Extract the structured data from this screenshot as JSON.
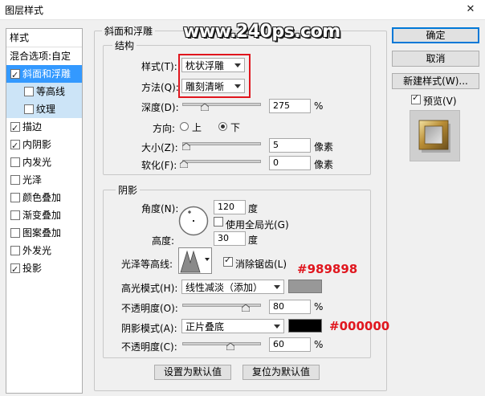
{
  "window": {
    "title": "图层样式",
    "close_glyph": "✕"
  },
  "watermark": "www.240ps.com",
  "left_list": {
    "header1": "样式",
    "header2": "混合选项:自定",
    "items": [
      {
        "label": "斜面和浮雕",
        "checked": true
      },
      {
        "label": "等高线",
        "checked": false
      },
      {
        "label": "纹理",
        "checked": false
      },
      {
        "label": "描边",
        "checked": true
      },
      {
        "label": "内阴影",
        "checked": true
      },
      {
        "label": "内发光",
        "checked": false
      },
      {
        "label": "光泽",
        "checked": false
      },
      {
        "label": "颜色叠加",
        "checked": false
      },
      {
        "label": "渐变叠加",
        "checked": false
      },
      {
        "label": "图案叠加",
        "checked": false
      },
      {
        "label": "外发光",
        "checked": false
      },
      {
        "label": "投影",
        "checked": true
      }
    ]
  },
  "bevel": {
    "group_title": "斜面和浮雕",
    "structure_title": "结构",
    "style_label": "样式(T):",
    "style_value": "枕状浮雕",
    "method_label": "方法(Q):",
    "method_value": "雕刻清晰",
    "depth_label": "深度(D):",
    "depth_value": "275",
    "depth_unit": "%",
    "direction_label": "方向:",
    "dir_up": "上",
    "dir_down": "下",
    "size_label": "大小(Z):",
    "size_value": "5",
    "size_unit": "像素",
    "soften_label": "软化(F):",
    "soften_value": "0",
    "soften_unit": "像素",
    "shading_title": "阴影",
    "angle_label": "角度(N):",
    "angle_value": "120",
    "angle_unit": "度",
    "global_light_label": "使用全局光(G)",
    "altitude_label": "高度:",
    "altitude_value": "30",
    "altitude_unit": "度",
    "gloss_label": "光泽等高线:",
    "antialias_label": "消除锯齿(L)",
    "highlight_label": "高光模式(H):",
    "highlight_value": "线性减淡（添加）",
    "highlight_color": "#989898",
    "opacity1_label": "不透明度(O):",
    "opacity1_value": "80",
    "opacity1_unit": "%",
    "shadow_label": "阴影模式(A):",
    "shadow_value": "正片叠底",
    "shadow_color": "#000000",
    "opacity2_label": "不透明度(C):",
    "opacity2_value": "60",
    "opacity2_unit": "%",
    "default_btn": "设置为默认值",
    "reset_btn": "复位为默认值"
  },
  "annotations": {
    "highlight_hex": "#989898",
    "shadow_hex": "#000000"
  },
  "right": {
    "ok": "确定",
    "cancel": "取消",
    "new_style": "新建样式(W)...",
    "preview_label": "预览(V)"
  },
  "colors": {
    "selection": "#3399ff",
    "sub_selection": "#cce4f7",
    "annotation_red": "#e0161e"
  }
}
